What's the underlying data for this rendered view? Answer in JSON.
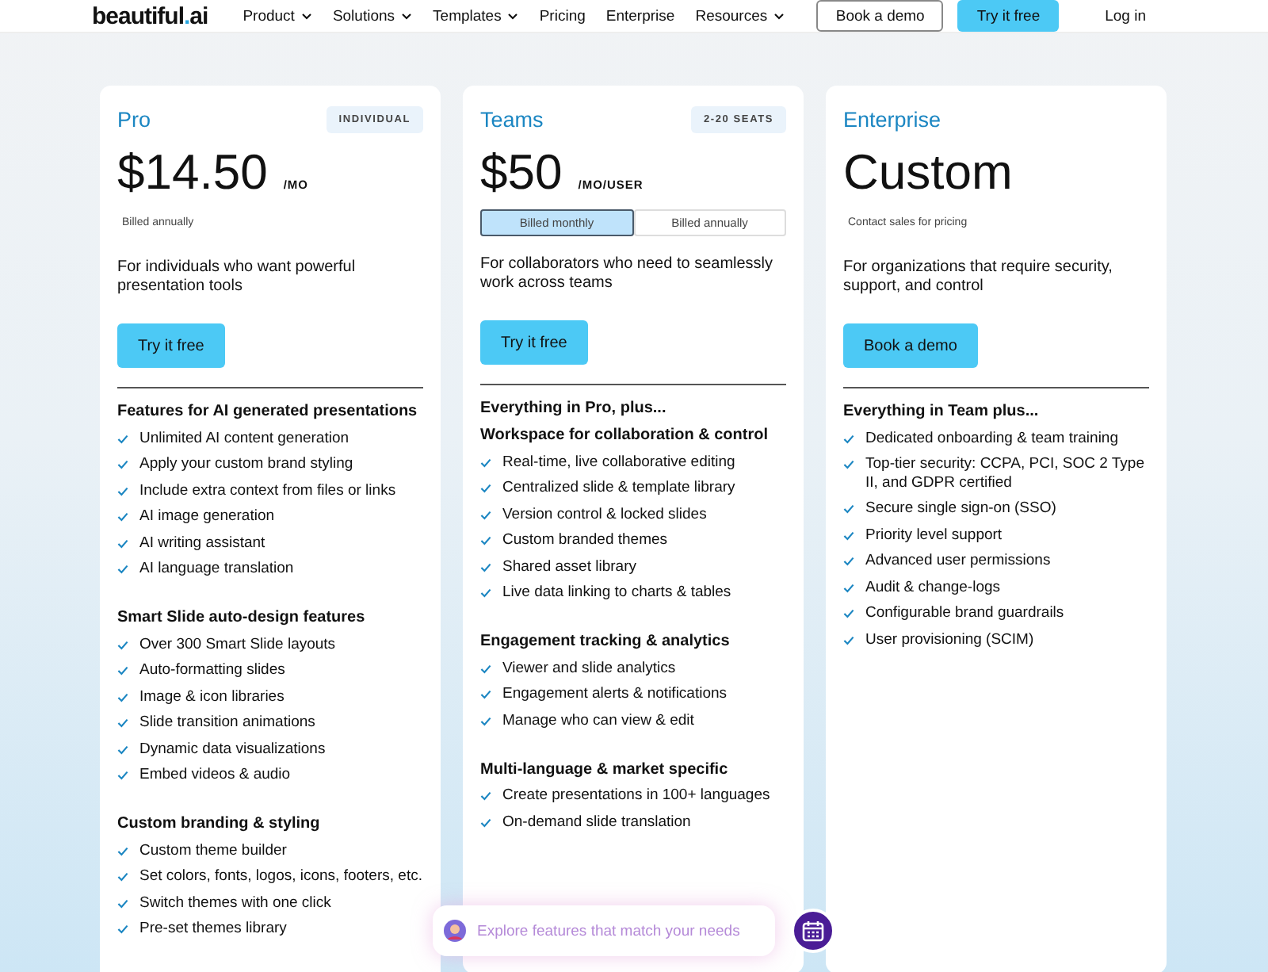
{
  "nav": {
    "logo": {
      "name": "beautiful",
      "dot": ".",
      "suffix": "ai"
    },
    "links": [
      {
        "label": "Product",
        "dropdown": true
      },
      {
        "label": "Solutions",
        "dropdown": true
      },
      {
        "label": "Templates",
        "dropdown": true
      },
      {
        "label": "Pricing",
        "dropdown": false
      },
      {
        "label": "Enterprise",
        "dropdown": false
      },
      {
        "label": "Resources",
        "dropdown": true
      }
    ],
    "actions": [
      {
        "label": "Book a demo",
        "kind": "outline"
      },
      {
        "label": "Try it free",
        "kind": "primary"
      },
      {
        "label": "Log in",
        "kind": "text"
      }
    ]
  },
  "plans": [
    {
      "name": "Pro",
      "badge": "INDIVIDUAL",
      "price": "$14.50",
      "unit": "/MO",
      "billing_note": "Billed annually",
      "description": "For individuals who want powerful presentation tools",
      "cta": "Try it free",
      "sections": [
        {
          "heading": "Features for AI generated presentations",
          "items": [
            "Unlimited AI content generation",
            "Apply your custom brand styling",
            "Include extra context from files or links",
            "AI image generation",
            "AI writing assistant",
            "AI language translation"
          ]
        },
        {
          "heading": "Smart Slide auto-design features",
          "items": [
            "Over 300 Smart Slide layouts",
            "Auto-formatting slides",
            "Image & icon libraries",
            "Slide transition animations",
            "Dynamic data visualizations",
            "Embed videos & audio"
          ]
        },
        {
          "heading": "Custom branding & styling",
          "items": [
            "Custom theme builder",
            "Set colors, fonts, logos, icons, footers, etc.",
            "Switch themes with one click",
            "Pre-set themes library"
          ]
        }
      ]
    },
    {
      "name": "Teams",
      "badge": "2-20 SEATS",
      "price": "$50",
      "unit": "/MO/USER",
      "billing_toggle": [
        {
          "label": "Billed monthly",
          "selected": true
        },
        {
          "label": "Billed annually",
          "selected": false
        }
      ],
      "description": "For collaborators who need to seamlessly work across teams",
      "cta": "Try it free",
      "intro": "Everything in Pro, plus...",
      "sections": [
        {
          "heading": "Workspace for collaboration & control",
          "items": [
            "Real-time, live collaborative editing",
            "Centralized slide & template library",
            "Version control & locked slides",
            "Custom branded themes",
            "Shared asset library",
            "Live data linking to charts & tables"
          ]
        },
        {
          "heading": "Engagement tracking & analytics",
          "items": [
            "Viewer and slide analytics",
            "Engagement alerts & notifications",
            "Manage who can view & edit"
          ]
        },
        {
          "heading": "Multi-language & market specific",
          "items": [
            "Create presentations in 100+ languages",
            "On-demand slide translation"
          ]
        }
      ]
    },
    {
      "name": "Enterprise",
      "price": "Custom",
      "billing_note": "Contact sales for pricing",
      "description": "For organizations that require security, support, and control",
      "cta": "Book a demo",
      "sections": [
        {
          "heading": "Everything in Team plus...",
          "items": [
            "Dedicated onboarding & team training",
            "Top-tier security: CCPA, PCI, SOC 2 Type II, and GDPR certified",
            "Secure single sign-on (SSO)",
            "Priority level support",
            "Advanced user permissions",
            "Audit & change-logs",
            "Configurable brand guardrails",
            "User provisioning (SCIM)"
          ]
        }
      ]
    }
  ],
  "assistant": {
    "placeholder": "Explore features that match your needs"
  }
}
